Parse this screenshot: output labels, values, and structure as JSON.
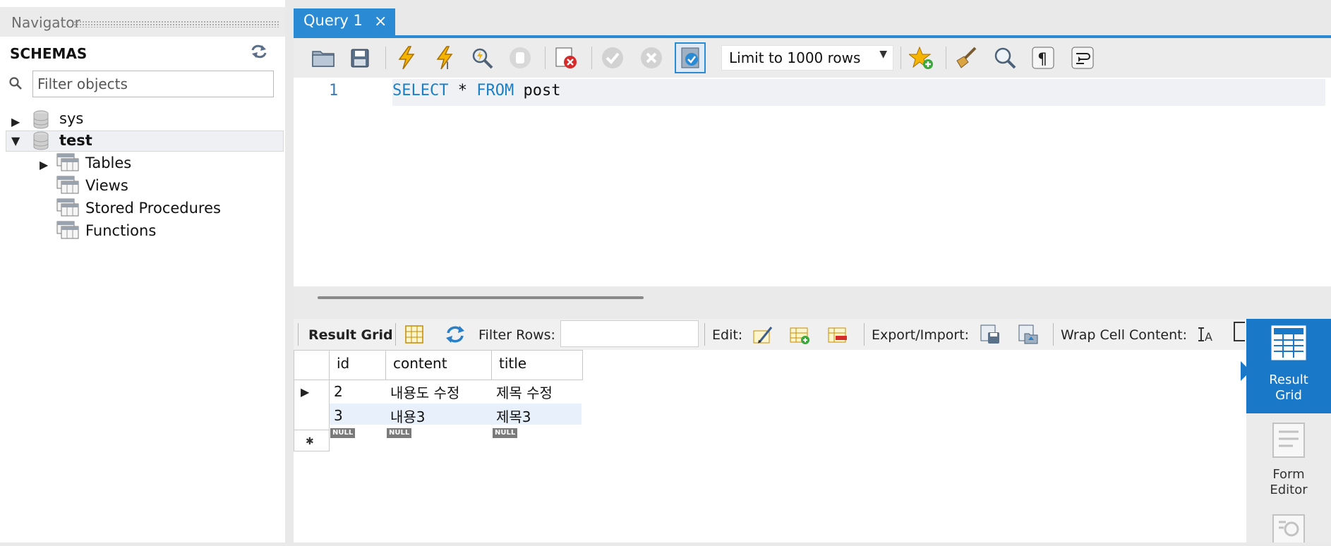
{
  "navigator": {
    "title": "Navigator",
    "schemas_label": "SCHEMAS",
    "filter_placeholder": "Filter objects",
    "schemas": [
      {
        "name": "sys",
        "expanded": false
      },
      {
        "name": "test",
        "expanded": true,
        "bold": true,
        "children": [
          "Tables",
          "Views",
          "Stored Procedures",
          "Functions"
        ]
      }
    ]
  },
  "tabs": [
    {
      "label": "Query 1",
      "active": true,
      "close": "×"
    }
  ],
  "toolbar": {
    "limit_label": "Limit to 1000 rows",
    "icons": [
      "open-folder-icon",
      "save-icon",
      "execute-icon",
      "execute-current-icon",
      "explain-icon",
      "stop-icon",
      "toggle-error-icon",
      "commit-icon",
      "rollback-icon",
      "autocommit-icon",
      "add-snippet-icon",
      "beautify-icon",
      "find-icon",
      "invisible-chars-icon",
      "word-wrap-icon"
    ]
  },
  "editor": {
    "line_number": "1",
    "tokens": [
      {
        "text": "SELECT",
        "type": "keyword"
      },
      {
        "text": " * ",
        "type": "plain"
      },
      {
        "text": "FROM",
        "type": "keyword"
      },
      {
        "text": " post",
        "type": "plain"
      }
    ]
  },
  "result_toolbar": {
    "result_grid": "Result Grid",
    "filter_rows": "Filter Rows:",
    "edit": "Edit:",
    "export_import": "Export/Import:",
    "wrap_cell": "Wrap Cell Content:"
  },
  "grid": {
    "columns": [
      "id",
      "content",
      "title"
    ],
    "rows": [
      [
        "2",
        "내용도 수정",
        "제목 수정"
      ],
      [
        "3",
        "내용3",
        "제목3"
      ]
    ],
    "null_label": "NULL"
  },
  "side_panel": {
    "result_grid_line1": "Result",
    "result_grid_line2": "Grid",
    "form_editor_line1": "Form",
    "form_editor_line2": "Editor"
  },
  "colors": {
    "accent": "#1a78c8",
    "keyword": "#1b7fc6",
    "line_number": "#3b7ab8"
  }
}
